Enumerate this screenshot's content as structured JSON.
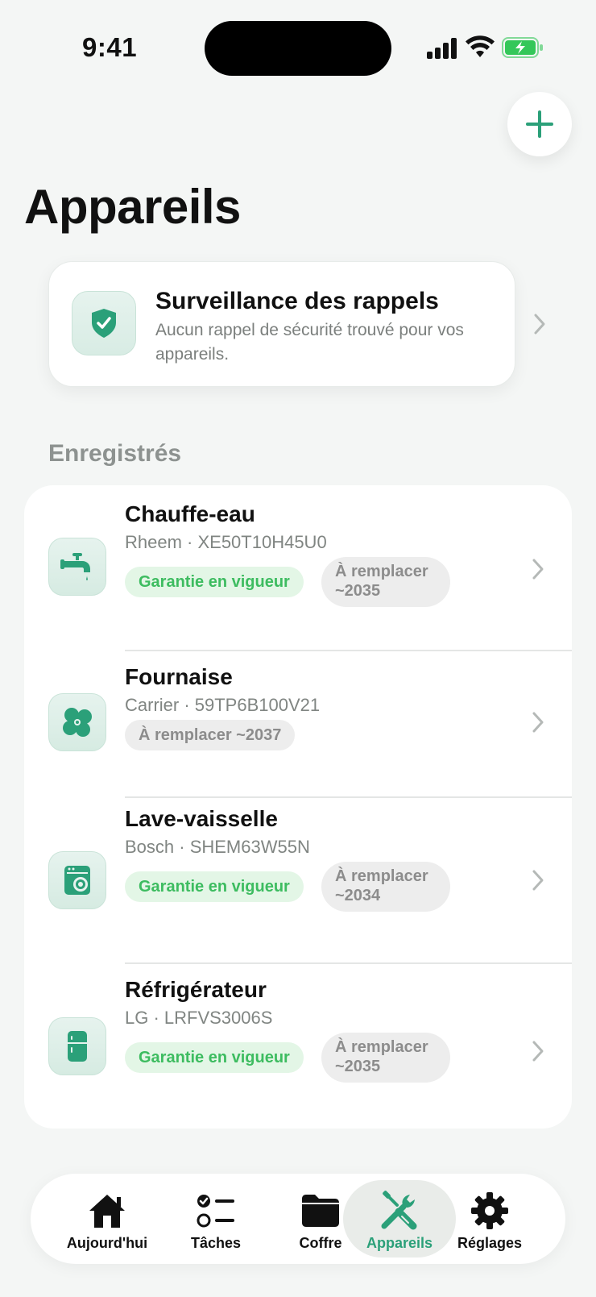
{
  "status_bar": {
    "time": "9:41"
  },
  "header": {
    "title": "Appareils",
    "add_icon": "plus-icon"
  },
  "recall_card": {
    "title": "Surveillance des rappels",
    "subtitle": "Aucun rappel de sécurité trouvé pour vos appareils.",
    "icon": "shield-check-icon"
  },
  "section": {
    "title": "Enregistrés"
  },
  "appliances": [
    {
      "name": "Chauffe-eau",
      "detail": "Rheem · XE50T10H45U0",
      "warranty": "Garantie en vigueur",
      "replace": "À remplacer ~2035",
      "icon": "faucet-icon"
    },
    {
      "name": "Fournaise",
      "detail": "Carrier · 59TP6B100V21",
      "warranty": "",
      "replace": "À remplacer ~2037",
      "icon": "fan-icon"
    },
    {
      "name": "Lave-vaisselle",
      "detail": "Bosch · SHEM63W55N",
      "warranty": "Garantie en vigueur",
      "replace": "À remplacer ~2034",
      "icon": "dishwasher-icon"
    },
    {
      "name": "Réfrigérateur",
      "detail": "LG · LRFVS3006S",
      "warranty": "Garantie en vigueur",
      "replace": "À remplacer ~2035",
      "icon": "fridge-icon"
    }
  ],
  "tabs": [
    {
      "label": "Aujourd'hui",
      "icon": "home-icon",
      "active": false
    },
    {
      "label": "Tâches",
      "icon": "tasks-icon",
      "active": false
    },
    {
      "label": "Coffre",
      "icon": "folder-icon",
      "active": false
    },
    {
      "label": "Appareils",
      "icon": "tools-icon",
      "active": true
    },
    {
      "label": "Réglages",
      "icon": "gear-icon",
      "active": false
    }
  ],
  "colors": {
    "accent": "#2ba079",
    "warranty_text": "#3dbc60",
    "warranty_bg": "#e3f6e6",
    "battery": "#34c759"
  }
}
